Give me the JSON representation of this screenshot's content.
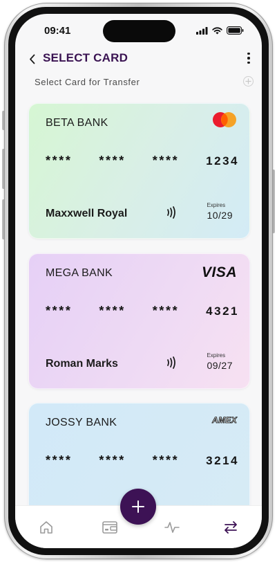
{
  "status_bar": {
    "time": "09:41"
  },
  "header": {
    "title": "SELECT CARD"
  },
  "section": {
    "subtitle": "Select Card for Transfer"
  },
  "cards": [
    {
      "bank": "BETA BANK",
      "masked": [
        "****",
        "****",
        "****"
      ],
      "last4": "1234",
      "holder": "Maxxwell Royal",
      "expires_label": "Expires",
      "expires": "10/29",
      "network": "mastercard-logo"
    },
    {
      "bank": "MEGA BANK",
      "masked": [
        "****",
        "****",
        "****"
      ],
      "last4": "4321",
      "holder": "Roman Marks",
      "expires_label": "Expires",
      "expires": "09/27",
      "network": "VISA"
    },
    {
      "bank": "JOSSY BANK",
      "masked": [
        "****",
        "****",
        "****"
      ],
      "last4": "3214",
      "network": "AMEX"
    }
  ],
  "bottom_nav": {
    "items": [
      "home-icon",
      "wallet-icon",
      "activity-icon",
      "transfer-icon"
    ],
    "fab": "plus-icon"
  },
  "colors": {
    "title": "#3a1352",
    "fab": "#3d1255",
    "active_nav": "#3d1255",
    "inactive_nav": "#9a9a9a"
  }
}
